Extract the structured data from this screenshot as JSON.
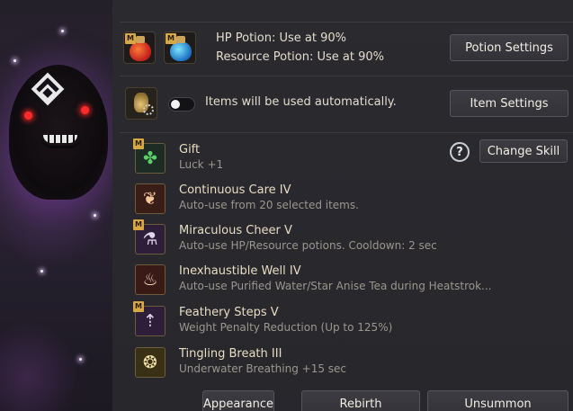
{
  "potions": {
    "hp_label": "HP Potion: Use at 90%",
    "resource_label": "Resource Potion: Use at 90%",
    "settings_button": "Potion Settings"
  },
  "items": {
    "auto_label": "Items will be used automatically.",
    "settings_button": "Item Settings",
    "toggle_on": false
  },
  "skills": {
    "help_label": "?",
    "change_button": "Change Skill",
    "list": [
      {
        "name": "Gift",
        "desc": "Luck +1",
        "badge": "M",
        "icon": "clover-icon"
      },
      {
        "name": "Continuous Care IV",
        "desc": "Auto-use from 20 selected items.",
        "badge": "",
        "icon": "fairy-icon"
      },
      {
        "name": "Miraculous Cheer V",
        "desc": "Auto-use HP/Resource potions. Cooldown: 2 sec",
        "badge": "M",
        "icon": "potion-flask-icon"
      },
      {
        "name": "Inexhaustible Well IV",
        "desc": "Auto-use Purified Water/Star Anise Tea during Heatstrok...",
        "badge": "",
        "icon": "teacup-icon"
      },
      {
        "name": "Feathery Steps V",
        "desc": "Weight Penalty Reduction (Up to 125%)",
        "badge": "M",
        "icon": "weight-arrow-icon"
      },
      {
        "name": "Tingling Breath III",
        "desc": "Underwater Breathing +15 sec",
        "badge": "",
        "icon": "bubbles-icon"
      }
    ]
  },
  "bottom": {
    "appearance": "Appearance",
    "rebirth": "Rebirth",
    "unsummon": "Unsummon"
  },
  "badge_text": "M"
}
